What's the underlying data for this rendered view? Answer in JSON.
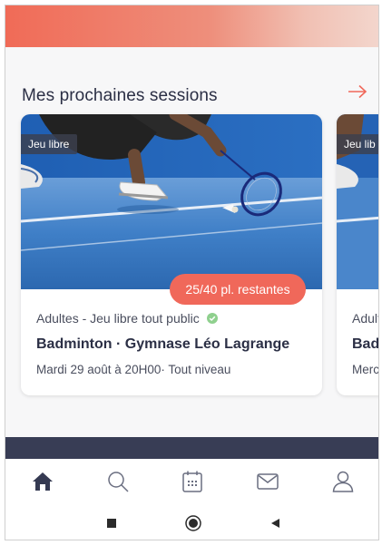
{
  "section": {
    "title": "Mes prochaines sessions",
    "see_all_icon": "arrow-right-icon"
  },
  "sessions": [
    {
      "tag": "Jeu libre",
      "seats": "25/40 pl. restantes",
      "audience": "Adultes - Jeu libre tout public",
      "verified_icon": "check-icon",
      "title": "Badminton · Gymnase Léo Lagrange",
      "details": "Mardi 29 août à 20H00· Tout niveau"
    },
    {
      "tag": "Jeu lib",
      "audience": "Adult",
      "title": "Badr",
      "details": "Merc"
    }
  ],
  "bottom_nav": [
    {
      "icon": "home-icon",
      "active": true
    },
    {
      "icon": "search-icon",
      "active": false
    },
    {
      "icon": "calendar-icon",
      "active": false
    },
    {
      "icon": "mail-icon",
      "active": false
    },
    {
      "icon": "user-icon",
      "active": false
    }
  ],
  "system_nav": [
    "recent-apps-icon",
    "home-circle-icon",
    "back-icon"
  ],
  "colors": {
    "accent": "#f0685a",
    "dark": "#2b2f45",
    "band": "#383d55",
    "check": "#7bc67a"
  }
}
